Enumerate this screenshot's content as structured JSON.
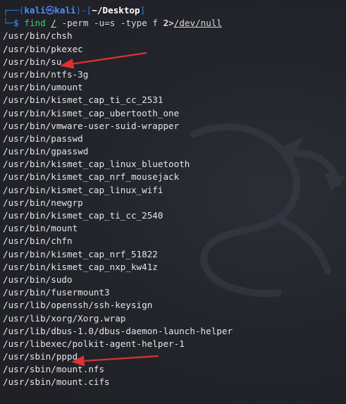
{
  "prompt": {
    "corner_top": "┌──(",
    "user": "kali",
    "skull": "㉿",
    "host": "kali",
    "mid": ")-[",
    "path": "~/Desktop",
    "end": "]",
    "corner_bottom": "└─",
    "dollar": "$"
  },
  "command": {
    "name": "find",
    "path_arg": "/",
    "args": "-perm -u=s -type f",
    "redirect": "2>",
    "target": "/dev/null"
  },
  "output": [
    "/usr/bin/chsh",
    "/usr/bin/pkexec",
    "/usr/bin/su",
    "/usr/bin/ntfs-3g",
    "/usr/bin/umount",
    "/usr/bin/kismet_cap_ti_cc_2531",
    "/usr/bin/kismet_cap_ubertooth_one",
    "/usr/bin/vmware-user-suid-wrapper",
    "/usr/bin/passwd",
    "/usr/bin/gpasswd",
    "/usr/bin/kismet_cap_linux_bluetooth",
    "/usr/bin/kismet_cap_nrf_mousejack",
    "/usr/bin/kismet_cap_linux_wifi",
    "/usr/bin/newgrp",
    "/usr/bin/kismet_cap_ti_cc_2540",
    "/usr/bin/mount",
    "/usr/bin/chfn",
    "/usr/bin/kismet_cap_nrf_51822",
    "/usr/bin/kismet_cap_nxp_kw41z",
    "/usr/bin/sudo",
    "/usr/bin/fusermount3",
    "/usr/lib/openssh/ssh-keysign",
    "/usr/lib/xorg/Xorg.wrap",
    "/usr/lib/dbus-1.0/dbus-daemon-launch-helper",
    "/usr/libexec/polkit-agent-helper-1",
    "/usr/sbin/pppd",
    "/usr/sbin/mount.nfs",
    "/usr/sbin/mount.cifs"
  ],
  "annotations": {
    "arrow_color": "#e03131",
    "arrow_targets": [
      "/usr/bin/su",
      "/usr/sbin/pppd"
    ]
  },
  "watermark_icon": "kali-dragon-icon"
}
